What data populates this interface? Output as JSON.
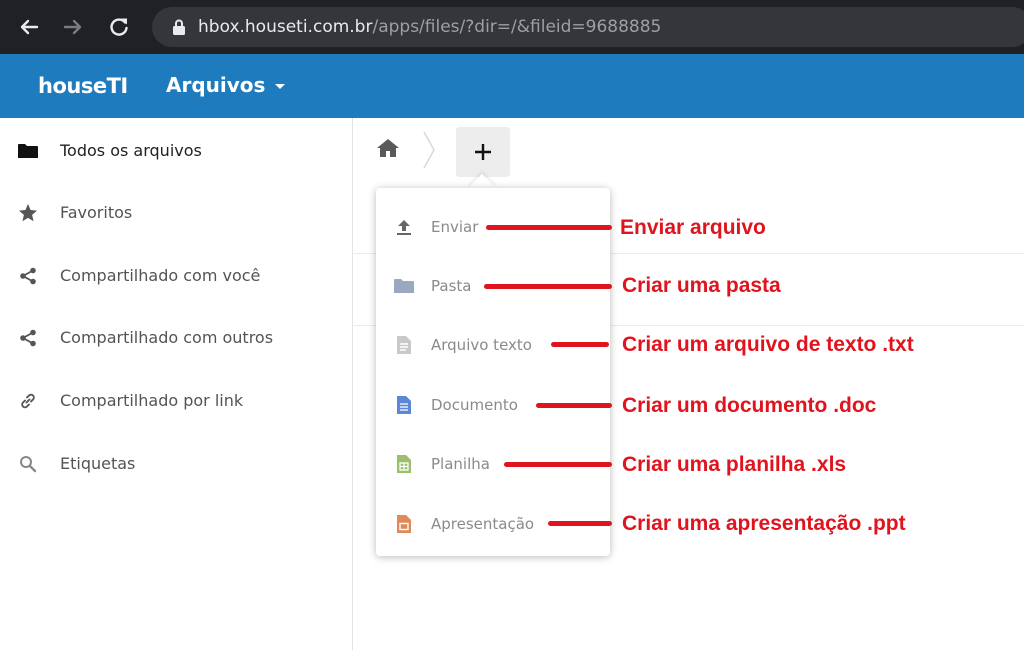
{
  "browser": {
    "url_host": "hbox.houseti.com.br",
    "url_path": "/apps/files/?dir=/&fileid=9688885"
  },
  "appbar": {
    "brand": "houseTI",
    "app_name": "Arquivos"
  },
  "sidebar": {
    "items": [
      {
        "label": "Todos os arquivos",
        "icon": "folder-icon"
      },
      {
        "label": "Favoritos",
        "icon": "star-icon"
      },
      {
        "label": "Compartilhado com você",
        "icon": "share-icon"
      },
      {
        "label": "Compartilhado com outros",
        "icon": "share-icon"
      },
      {
        "label": "Compartilhado por link",
        "icon": "link-icon"
      },
      {
        "label": "Etiquetas",
        "icon": "search-icon"
      }
    ]
  },
  "new_menu": {
    "items": [
      {
        "label": "Enviar",
        "icon": "upload-icon"
      },
      {
        "label": "Pasta",
        "icon": "folder-icon"
      },
      {
        "label": "Arquivo texto",
        "icon": "text-file-icon"
      },
      {
        "label": "Documento",
        "icon": "document-icon"
      },
      {
        "label": "Planilha",
        "icon": "spreadsheet-icon"
      },
      {
        "label": "Apresentação",
        "icon": "presentation-icon"
      }
    ]
  },
  "annotations": [
    "Enviar arquivo",
    "Criar uma pasta",
    "Criar um arquivo de texto .txt",
    "Criar um documento .doc",
    "Criar uma planilha .xls",
    "Criar uma apresentação .ppt"
  ],
  "colors": {
    "brand_blue": "#1e7bbd",
    "annotation_red": "#e0141e",
    "doc_blue": "#5b87d4",
    "sheet_green": "#9bbf6a",
    "slide_orange": "#e08a5c",
    "folder_gray": "#9aa9bf"
  }
}
